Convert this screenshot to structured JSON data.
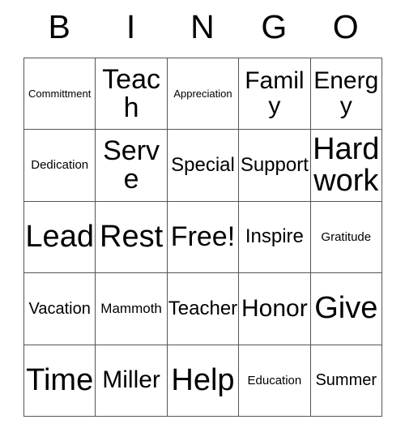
{
  "card": {
    "header": {
      "letters": [
        "B",
        "I",
        "N",
        "G",
        "O"
      ]
    },
    "rows": [
      [
        {
          "text": "Committment",
          "size": "fs-min"
        },
        {
          "text": "Teach",
          "size": "fs-xl"
        },
        {
          "text": "Appreciation",
          "size": "fs-min"
        },
        {
          "text": "Family",
          "size": "fs-lg"
        },
        {
          "text": "Energy",
          "size": "fs-lg"
        }
      ],
      [
        {
          "text": "Dedication",
          "size": "fs-xxs"
        },
        {
          "text": "Serve",
          "size": "fs-xl"
        },
        {
          "text": "Special",
          "size": "fs-md"
        },
        {
          "text": "Support",
          "size": "fs-md"
        },
        {
          "text": "Hard work",
          "size": "fs-xxl"
        }
      ],
      [
        {
          "text": "Lead",
          "size": "fs-xxl"
        },
        {
          "text": "Rest",
          "size": "fs-xxl"
        },
        {
          "text": "Free!",
          "size": "fs-xl"
        },
        {
          "text": "Inspire",
          "size": "fs-md"
        },
        {
          "text": "Gratitude",
          "size": "fs-xxs"
        }
      ],
      [
        {
          "text": "Vacation",
          "size": "fs-sm"
        },
        {
          "text": "Mammoth",
          "size": "fs-xs"
        },
        {
          "text": "Teacher",
          "size": "fs-md"
        },
        {
          "text": "Honor",
          "size": "fs-lg"
        },
        {
          "text": "Give",
          "size": "fs-xxl"
        }
      ],
      [
        {
          "text": "Time",
          "size": "fs-xxl"
        },
        {
          "text": "Miller",
          "size": "fs-lg"
        },
        {
          "text": "Help",
          "size": "fs-xxl"
        },
        {
          "text": "Education",
          "size": "fs-xxs"
        },
        {
          "text": "Summer",
          "size": "fs-sm"
        }
      ]
    ],
    "free_space": {
      "row": 2,
      "col": 2,
      "label": "Free!"
    },
    "colors": {
      "background": "#ffffff",
      "text": "#000000",
      "grid_line": "#555555"
    }
  }
}
